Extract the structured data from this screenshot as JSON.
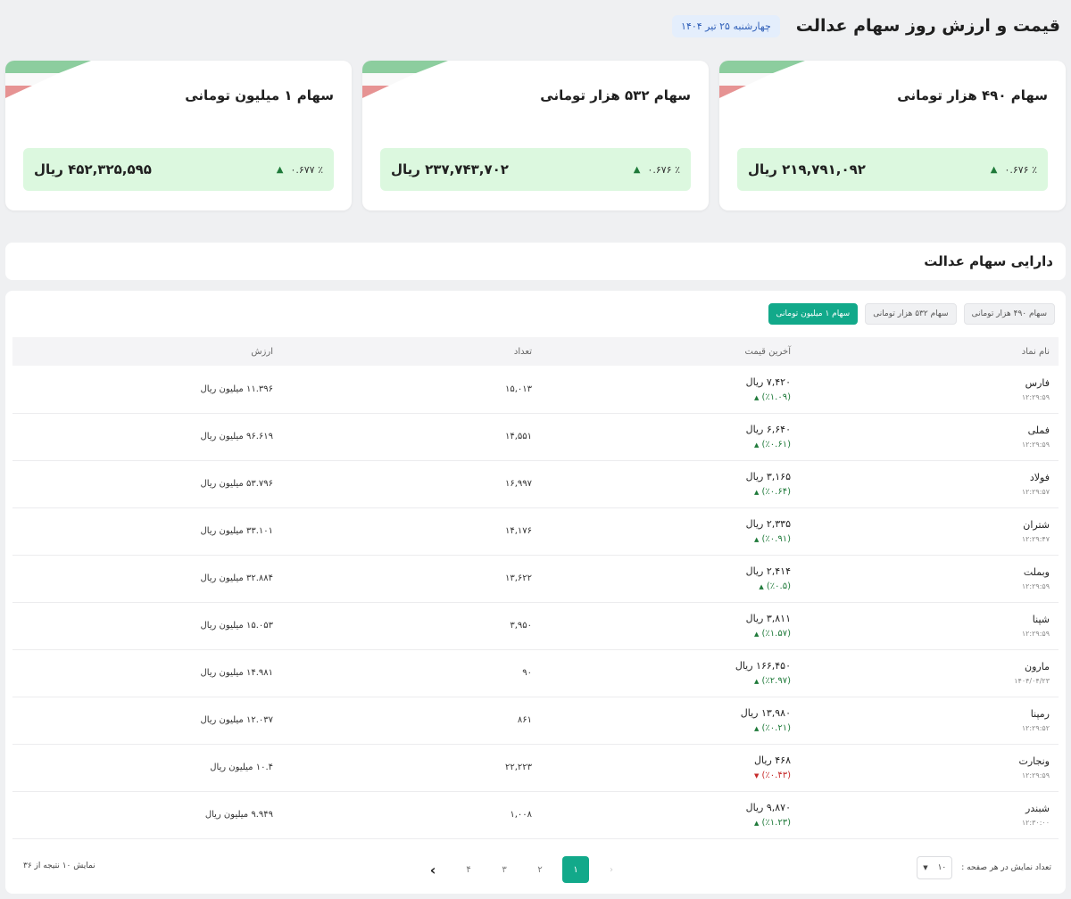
{
  "header": {
    "title": "قیمت و ارزش روز سهام عدالت",
    "date_badge": "چهارشنبه ۲۵ تیر ۱۴۰۴"
  },
  "cards": [
    {
      "title": "سهام ۴۹۰ هزار تومانی",
      "amount": "۲۱۹,۷۹۱,۰۹۲ ریال",
      "change": "٪ ۰.۶۷۶"
    },
    {
      "title": "سهام ۵۳۲ هزار تومانی",
      "amount": "۲۳۷,۷۴۳,۷۰۲ ریال",
      "change": "٪ ۰.۶۷۶"
    },
    {
      "title": "سهام ۱ میلیون تومانی",
      "amount": "۴۵۲,۳۲۵,۵۹۵ ریال",
      "change": "٪ ۰.۶۷۷"
    }
  ],
  "section": {
    "title": "دارایی سهام عدالت"
  },
  "tabs": [
    {
      "label": "سهام ۴۹۰ هزار تومانی",
      "active": false
    },
    {
      "label": "سهام ۵۳۲ هزار تومانی",
      "active": false
    },
    {
      "label": "سهام ۱ میلیون تومانی",
      "active": true
    }
  ],
  "table": {
    "headers": {
      "name": "نام نماد",
      "price": "آخرین قیمت",
      "count": "تعداد",
      "value": "ارزش"
    },
    "rows": [
      {
        "name": "فارس",
        "time": "۱۲:۲۹:۵۹",
        "price": "۷,۴۲۰ ریال",
        "change": "(٪۱.۰۹)",
        "dir": "up",
        "count": "۱۵,۰۱۳",
        "value": "۱۱.۳۹۶ میلیون ریال"
      },
      {
        "name": "فملی",
        "time": "۱۲:۲۹:۵۹",
        "price": "۶,۶۴۰ ریال",
        "change": "(٪۰.۶۱)",
        "dir": "up",
        "count": "۱۴,۵۵۱",
        "value": "۹۶.۶۱۹ میلیون ریال"
      },
      {
        "name": "فولاد",
        "time": "۱۲:۲۹:۵۷",
        "price": "۳,۱۶۵ ریال",
        "change": "(٪۰.۶۴)",
        "dir": "up",
        "count": "۱۶,۹۹۷",
        "value": "۵۳.۷۹۶ میلیون ریال"
      },
      {
        "name": "شتران",
        "time": "۱۲:۲۹:۴۷",
        "price": "۲,۳۳۵ ریال",
        "change": "(٪۰.۹۱)",
        "dir": "up",
        "count": "۱۴,۱۷۶",
        "value": "۳۳.۱۰۱ میلیون ریال"
      },
      {
        "name": "وبملت",
        "time": "۱۲:۲۹:۵۹",
        "price": "۲,۴۱۴ ریال",
        "change": "(٪۰.۵)",
        "dir": "up",
        "count": "۱۳,۶۲۲",
        "value": "۳۲.۸۸۴ میلیون ریال"
      },
      {
        "name": "شپنا",
        "time": "۱۲:۲۹:۵۹",
        "price": "۳,۸۱۱ ریال",
        "change": "(٪۱.۵۷)",
        "dir": "up",
        "count": "۳,۹۵۰",
        "value": "۱۵.۰۵۳ میلیون ریال"
      },
      {
        "name": "مارون",
        "time": "۱۴۰۴/۰۴/۲۳",
        "price": "۱۶۶,۴۵۰ ریال",
        "change": "(٪۲.۹۷)",
        "dir": "up",
        "count": "۹۰",
        "value": "۱۴.۹۸۱ میلیون ریال"
      },
      {
        "name": "رمپنا",
        "time": "۱۲:۲۹:۵۲",
        "price": "۱۳,۹۸۰ ریال",
        "change": "(٪۰.۲۱)",
        "dir": "up",
        "count": "۸۶۱",
        "value": "۱۲.۰۳۷ میلیون ریال"
      },
      {
        "name": "ونجارت",
        "time": "۱۲:۲۹:۵۹",
        "price": "۴۶۸ ریال",
        "change": "(٪۰.۴۳)",
        "dir": "down",
        "count": "۲۲,۲۲۳",
        "value": "۱۰.۴ میلیون ریال"
      },
      {
        "name": "شبندر",
        "time": "۱۲:۳۰:۰۰",
        "price": "۹,۸۷۰ ریال",
        "change": "(٪۱.۲۳)",
        "dir": "up",
        "count": "۱,۰۰۸",
        "value": "۹.۹۴۹ میلیون ریال"
      }
    ]
  },
  "footer": {
    "per_page_label": "تعداد نمایش در هر صفحه :",
    "per_page_value": "۱۰",
    "pages": [
      "۱",
      "۲",
      "۳",
      "۴"
    ],
    "results_text": "نمایش ۱۰ نتیجه از ۳۶"
  },
  "colors": {
    "accent": "#12a98a",
    "up": "#1f7a3a",
    "down": "#c62828",
    "card_value_bg": "#dcf8df"
  }
}
